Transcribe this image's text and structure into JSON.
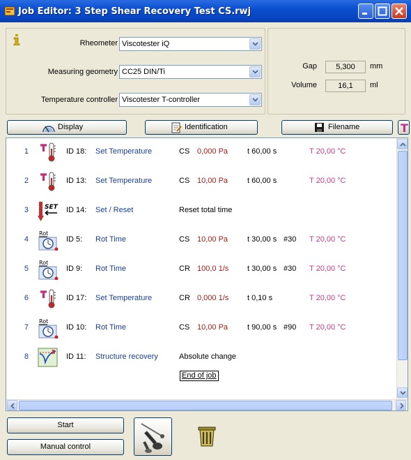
{
  "window": {
    "title": "Job Editor: 3 Step Shear Recovery Test CS.rwj"
  },
  "settings": {
    "rheometer": {
      "label": "Rheometer",
      "value": "Viscotester iQ"
    },
    "geometry": {
      "label": "Measuring geometry",
      "value": "CC25 DIN/Ti"
    },
    "temp_controller": {
      "label": "Temperature controller",
      "value": "Viscotester T-controller"
    }
  },
  "gap": {
    "label": "Gap",
    "value": "5,300",
    "unit": "mm"
  },
  "volume": {
    "label": "Volume",
    "value": "16,1",
    "unit": "ml"
  },
  "toolbar": {
    "display": "Display",
    "identification": "Identification",
    "filename": "Filename"
  },
  "steps": [
    {
      "num": "1",
      "icon": "thermometer-icon",
      "id": "ID 18:",
      "name": "Set Temperature",
      "mode": "CS",
      "value": "0,000 Pa",
      "time": "t 60,00 s",
      "count": "",
      "temp": "T 20,00 °C"
    },
    {
      "num": "2",
      "icon": "thermometer-icon",
      "id": "ID 13:",
      "name": "Set Temperature",
      "mode": "CS",
      "value": "10,00 Pa",
      "time": "t 60,00 s",
      "count": "",
      "temp": "T 20,00 °C"
    },
    {
      "num": "3",
      "icon": "set-reset-icon",
      "id": "ID 14:",
      "name": "Set / Reset",
      "plain": "Reset total time"
    },
    {
      "num": "4",
      "icon": "rot-time-icon",
      "id": "ID 5:",
      "name": "Rot Time",
      "mode": "CS",
      "value": "10,00 Pa",
      "time": "t 30,00 s",
      "count": "#30",
      "temp": "T 20,00 °C"
    },
    {
      "num": "5",
      "icon": "rot-time-icon",
      "id": "ID 9:",
      "name": "Rot Time",
      "mode": "CR",
      "value": "100,0 1/s",
      "time": "t 30,00 s",
      "count": "#30",
      "temp": "T 20,00 °C"
    },
    {
      "num": "6",
      "icon": "thermometer-icon",
      "id": "ID 17:",
      "name": "Set Temperature",
      "mode": "CR",
      "value": "0,000 1/s",
      "time": "t 0,10 s",
      "count": "",
      "temp": "T 20,00 °C"
    },
    {
      "num": "7",
      "icon": "rot-time-icon",
      "id": "ID 10:",
      "name": "Rot Time",
      "mode": "CS",
      "value": "10,00 Pa",
      "time": "t 90,00 s",
      "count": "#90",
      "temp": "T 20,00 °C"
    },
    {
      "num": "8",
      "icon": "structure-recovery-icon",
      "id": "ID 11:",
      "name": "Structure recovery",
      "plain": "Absolute change"
    }
  ],
  "end_label": "End of job",
  "icon_text": {
    "rot": "Rot",
    "set": "SET",
    "t": "T"
  },
  "buttons": {
    "start": "Start",
    "manual": "Manual control"
  }
}
